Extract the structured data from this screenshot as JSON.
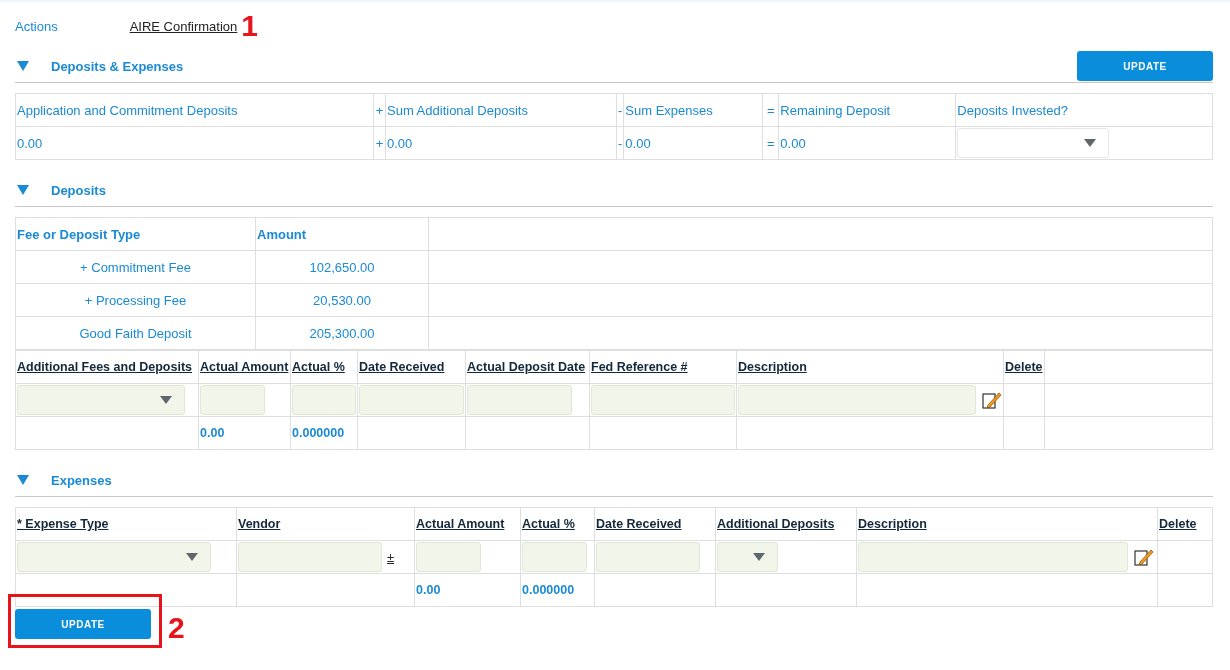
{
  "top_nav": {
    "actions_link": "Actions",
    "breadcrumb_link": "AIRE Confirmation",
    "annotation": "1"
  },
  "deposits_expenses": {
    "title": "Deposits & Expenses",
    "expanded": true,
    "update_button": "UPDATE",
    "summary": [
      {
        "kind": "value",
        "label": "Application and Commitment Deposits",
        "value": "0.00"
      },
      {
        "kind": "value",
        "label_operator": "+",
        "label": "Sum Additional Deposits",
        "value_operator": "+",
        "value": "0.00"
      },
      {
        "kind": "value",
        "label_operator": "-",
        "label": "Sum Expenses",
        "value_operator": "-",
        "value": "0.00"
      },
      {
        "kind": "value",
        "label_operator": "=",
        "label": "Remaining Deposit",
        "value_operator": "=",
        "value": "0.00"
      },
      {
        "kind": "select",
        "label": "Deposits Invested?"
      }
    ]
  },
  "deposits": {
    "title": "Deposits",
    "expanded": true,
    "fee_table": {
      "columns": [
        "Fee or Deposit Type",
        "Amount"
      ],
      "rows": [
        {
          "type": "+ Commitment Fee",
          "amount": "102,650.00"
        },
        {
          "type": "+ Processing Fee",
          "amount": "20,530.00"
        },
        {
          "type": "Good Faith Deposit",
          "amount": "205,300.00"
        }
      ]
    },
    "additional_table": {
      "columns": [
        {
          "label": "Additional Fees and Deposits",
          "kind": "select"
        },
        {
          "label": "Actual Amount",
          "kind": "field",
          "total": "0.00"
        },
        {
          "label": "Actual %",
          "kind": "field",
          "total": "0.000000"
        },
        {
          "label": "Date Received",
          "kind": "field"
        },
        {
          "label": "Actual Deposit Date",
          "kind": "field"
        },
        {
          "label": "Fed Reference #",
          "kind": "field"
        },
        {
          "label": "Description",
          "kind": "text"
        },
        {
          "label": "Delete",
          "kind": "none"
        }
      ]
    }
  },
  "expenses": {
    "title": "Expenses",
    "expanded": true,
    "table": {
      "columns": [
        {
          "label": "* Expense Type",
          "kind": "select"
        },
        {
          "label": "Vendor",
          "kind": "field",
          "extra_link": "±"
        },
        {
          "label": "Actual Amount",
          "kind": "field",
          "total": "0.00"
        },
        {
          "label": "Actual %",
          "kind": "field",
          "total": "0.000000"
        },
        {
          "label": "Date Received",
          "kind": "field"
        },
        {
          "label": "Additional Deposits",
          "kind": "select"
        },
        {
          "label": "Description",
          "kind": "text"
        },
        {
          "label": "Delete",
          "kind": "none"
        }
      ]
    }
  },
  "footer": {
    "update_button": "UPDATE",
    "annotation": "2"
  }
}
